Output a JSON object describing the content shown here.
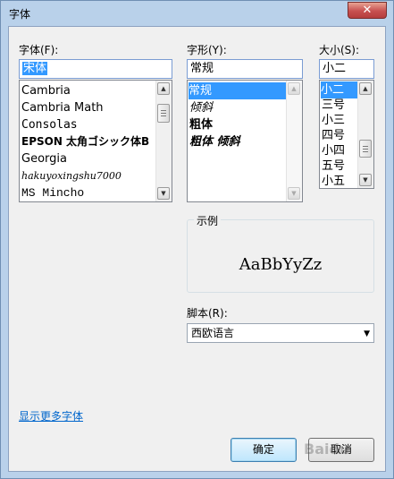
{
  "window": {
    "title": "字体",
    "close_glyph": "✕"
  },
  "font": {
    "label": "字体(F):",
    "value": "宋体",
    "items": [
      "Cambria",
      "Cambria Math",
      "Consolas",
      "EPSON 太角ゴシック体B",
      "Georgia",
      "hakuyoxingshu7000",
      "MS Mincho"
    ]
  },
  "style": {
    "label": "字形(Y):",
    "value": "常规",
    "items": [
      "常规",
      "倾斜",
      "粗体",
      "粗体 倾斜"
    ],
    "selected": "常规"
  },
  "size": {
    "label": "大小(S):",
    "value": "小二",
    "items": [
      "小二",
      "三号",
      "小三",
      "四号",
      "小四",
      "五号",
      "小五"
    ],
    "selected": "小二"
  },
  "sample": {
    "label": "示例",
    "text": "AaBbYyZz"
  },
  "script": {
    "label": "脚本(R):",
    "value": "西欧语言"
  },
  "more_fonts_link": "显示更多字体",
  "buttons": {
    "ok": "确定",
    "cancel": "取消"
  },
  "watermark": "Baidu"
}
